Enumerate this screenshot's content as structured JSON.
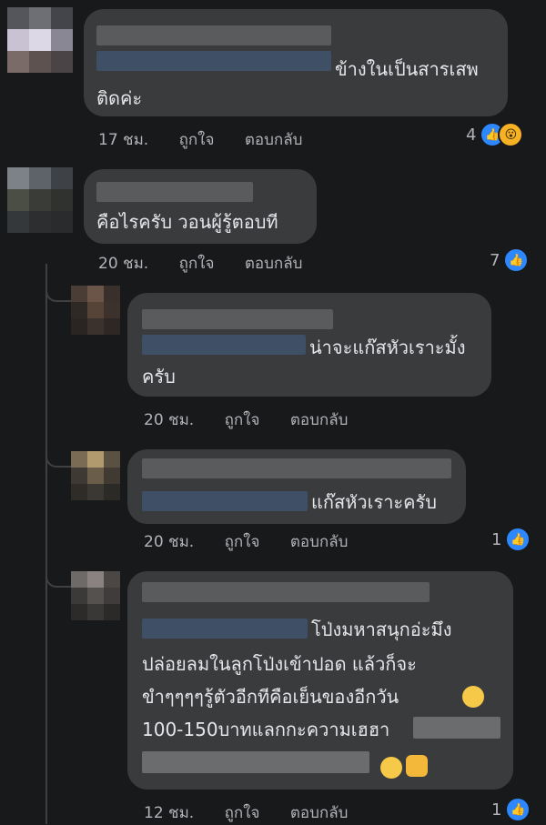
{
  "comments": [
    {
      "text_lines": [
        "ข้างในเป็นสารเสพ",
        "ติดค่ะ"
      ],
      "time": "17 ชม.",
      "like_label": "ถูกใจ",
      "reply_label": "ตอบกลับ",
      "reaction_count": "4"
    },
    {
      "text_lines": [
        "คือไรครับ วอนผู้รู้ตอบที"
      ],
      "time": "20 ชม.",
      "like_label": "ถูกใจ",
      "reply_label": "ตอบกลับ",
      "reaction_count": "7"
    },
    {
      "text_lines": [
        "น่าจะแก๊สหัวเราะมั้ง",
        "ครับ"
      ],
      "time": "20 ชม.",
      "like_label": "ถูกใจ",
      "reply_label": "ตอบกลับ"
    },
    {
      "text_lines": [
        "แก๊สหัวเราะครับ"
      ],
      "time": "20 ชม.",
      "like_label": "ถูกใจ",
      "reply_label": "ตอบกลับ",
      "reaction_count": "1"
    },
    {
      "text_lines": [
        "โป่งมหาสนุกอ่ะมึง",
        "ปล่อยลมในลูกโป่งเข้าปอด แล้วก็จะ",
        "ขำๆๆๆๆรู้ตัวอีกทีคือเย็นของอีกวัน",
        "100-150บาทแลกกะความเฮฮา"
      ],
      "time": "12 ชม.",
      "like_label": "ถูกใจ",
      "reply_label": "ตอบกลับ",
      "reaction_count": "1"
    }
  ],
  "colors": {
    "background": "#18191a",
    "bubble": "#3a3b3c",
    "like_blue": "#2d88ff",
    "wow_yellow": "#f7b125"
  },
  "icons": [
    "like-reaction-icon",
    "wow-reaction-icon",
    "grinning-sweat-emoji",
    "smiling-emoji",
    "victory-hand-emoji"
  ]
}
